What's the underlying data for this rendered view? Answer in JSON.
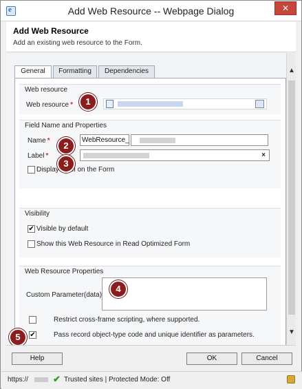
{
  "window": {
    "title": "Add Web Resource -- Webpage Dialog",
    "close_icon": "close-icon"
  },
  "header": {
    "title": "Add Web Resource",
    "description": "Add an existing web resource to the Form."
  },
  "tabs": [
    {
      "label": "General",
      "active": true
    },
    {
      "label": "Formatting",
      "active": false
    },
    {
      "label": "Dependencies",
      "active": false
    }
  ],
  "sections": {
    "web_resource": {
      "title": "Web resource",
      "field_label": "Web resource"
    },
    "field_name": {
      "title": "Field Name and Properties",
      "name_label": "Name",
      "name_prefix": "WebResource_",
      "label_label": "Label",
      "clear": "×",
      "display_label": "Display label on the Form"
    },
    "visibility": {
      "title": "Visibility",
      "visible_default": "Visible by default",
      "read_optimized": "Show this Web Resource in Read Optimized Form"
    },
    "properties": {
      "title": "Web Resource Properties",
      "custom_param": "Custom Parameter(data)",
      "restrict_scripting": "Restrict cross-frame scripting, where supported.",
      "pass_record": "Pass record object-type code and unique identifier as parameters."
    }
  },
  "required_marker": "*",
  "checkboxes": {
    "display_label": false,
    "visible_default": true,
    "read_optimized": false,
    "restrict_scripting": false,
    "pass_record": true
  },
  "check_glyph": "✔",
  "callouts": [
    "1",
    "2",
    "3",
    "4",
    "5"
  ],
  "buttons": {
    "help": "Help",
    "ok": "OK",
    "cancel": "Cancel"
  },
  "status": {
    "url_prefix": "https://",
    "zone": "Trusted sites | Protected Mode: Off"
  },
  "colors": {
    "callout": "#8b1d1d",
    "close": "#c7463b",
    "required": "#c0392b"
  }
}
